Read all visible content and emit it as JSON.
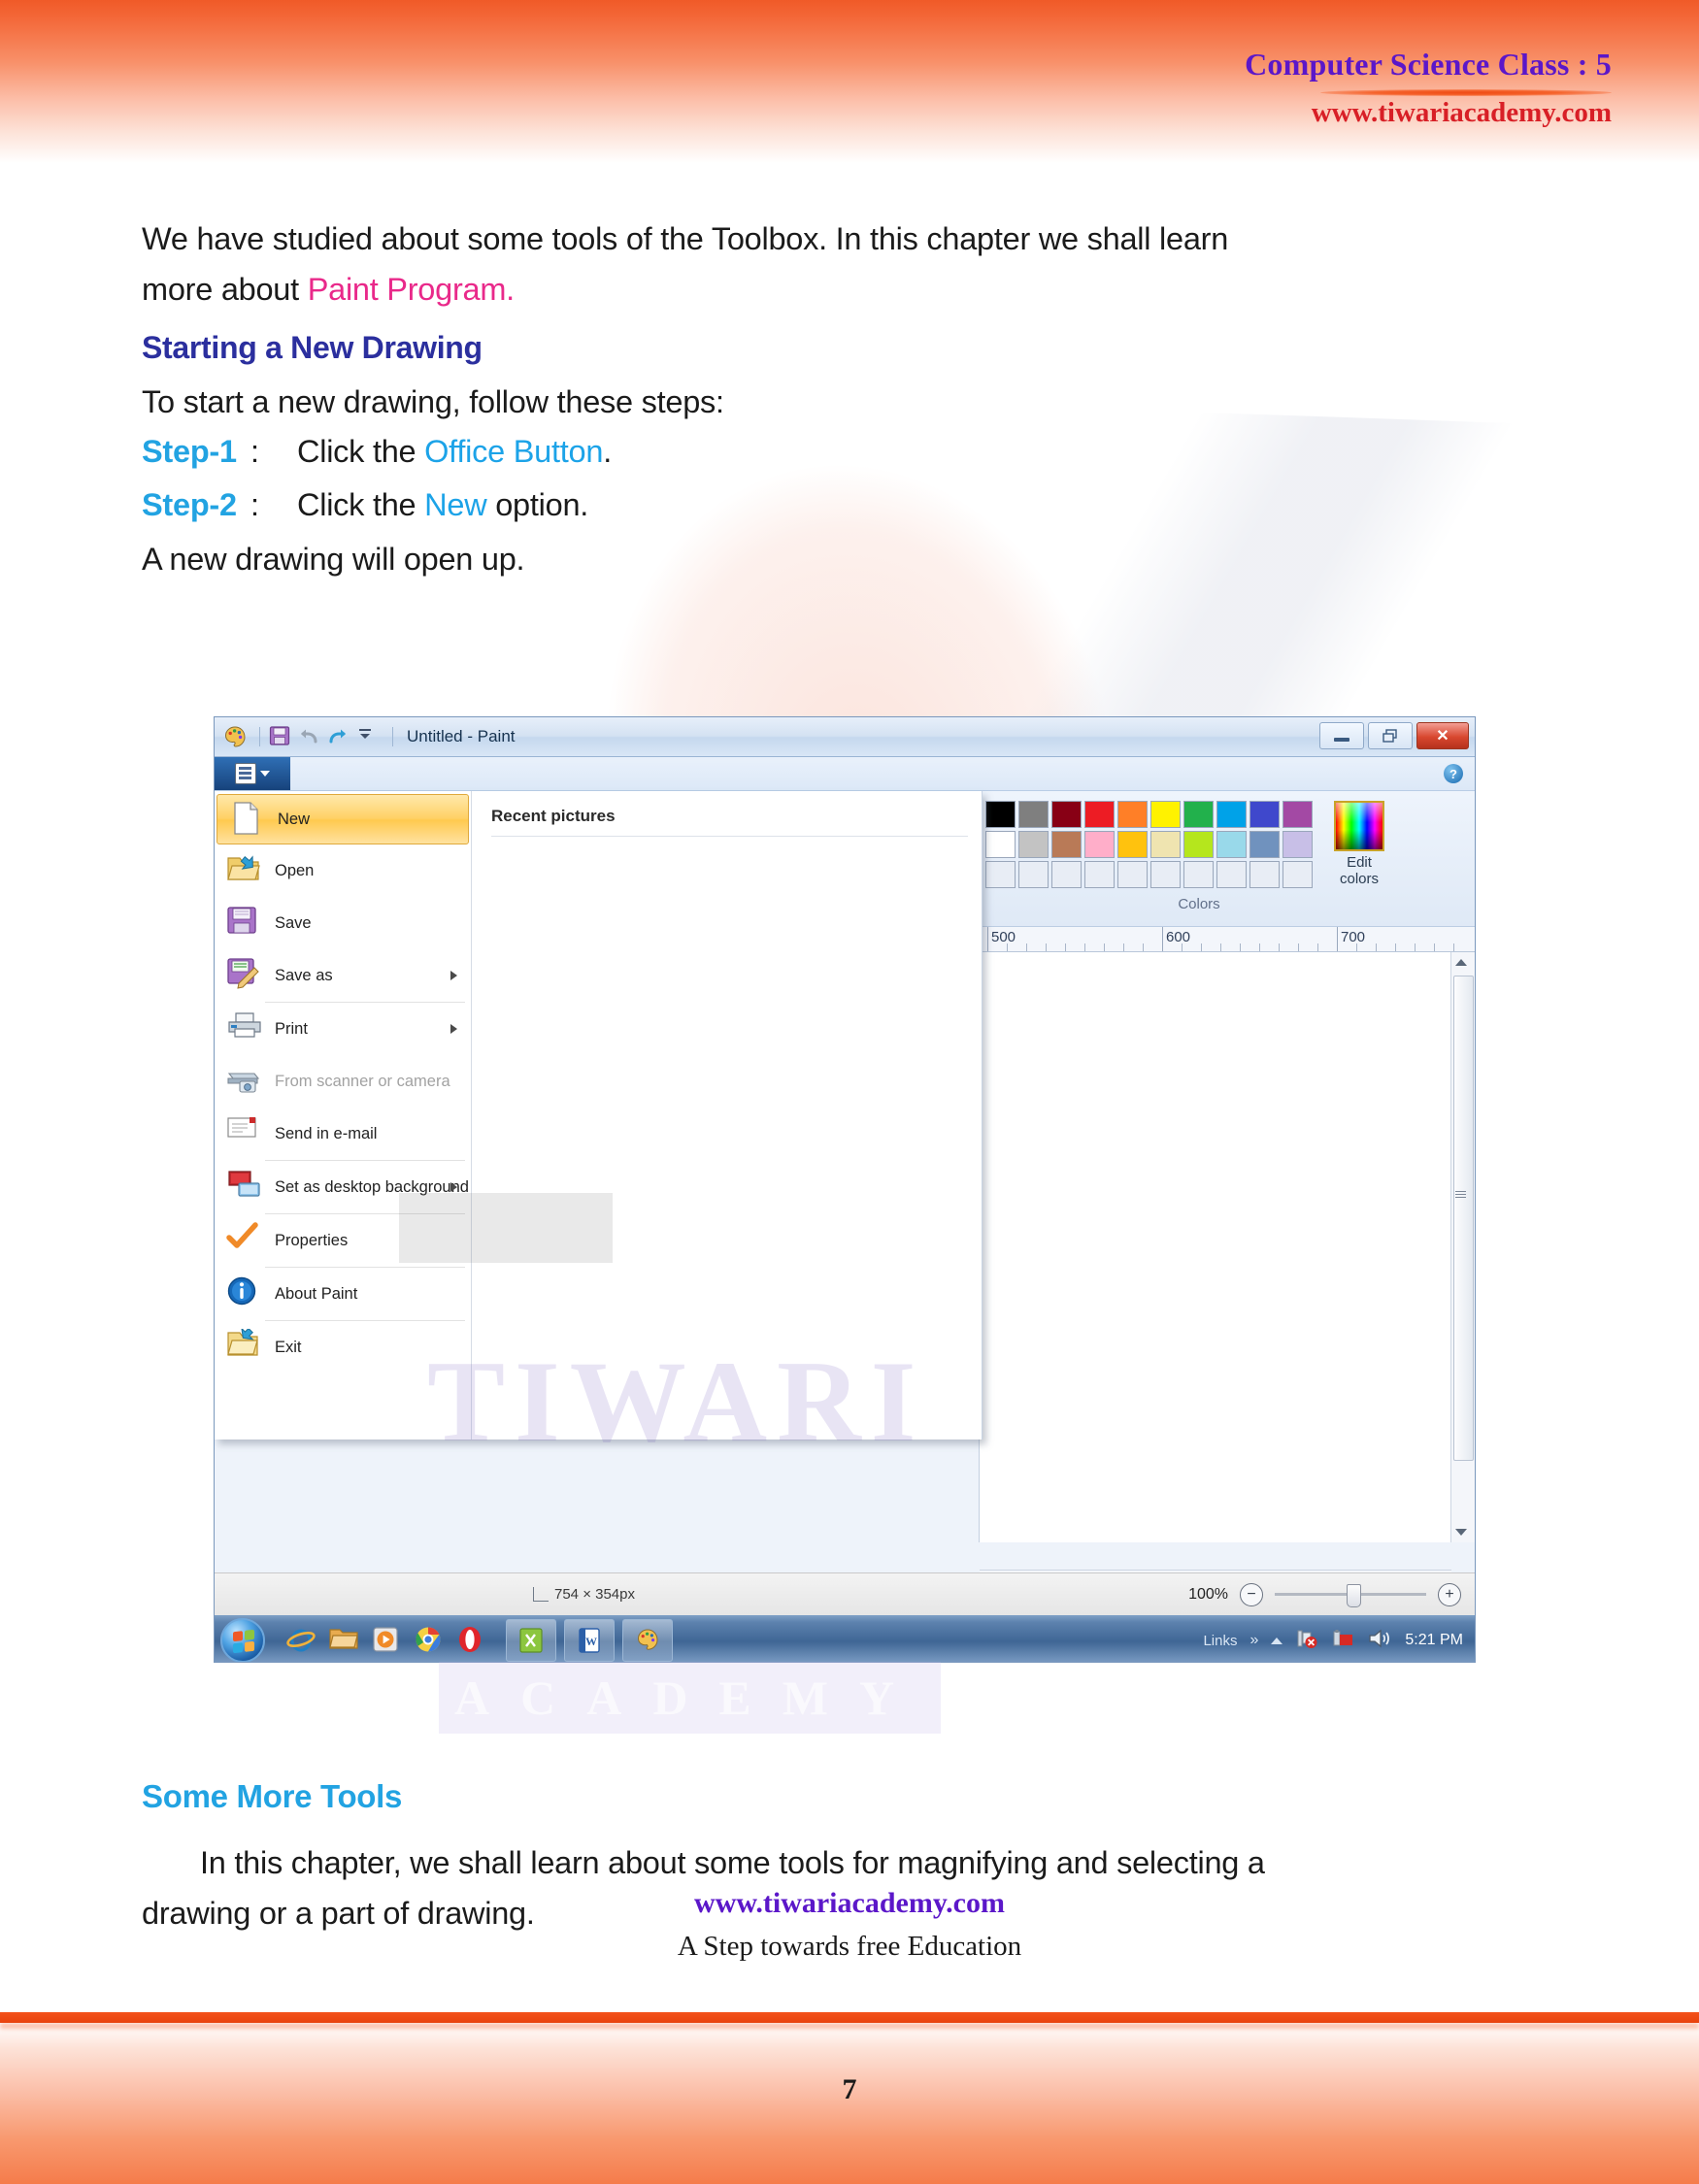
{
  "header": {
    "title": "Computer Science Class : 5",
    "site": "www.tiwariacademy.com"
  },
  "body": {
    "intro_1": "We have studied about some tools of the Toolbox. In this chapter we shall learn",
    "intro_2_pre": "more about ",
    "intro_2_em": "Paint Program.",
    "heading_1": "Starting a New Drawing",
    "lead": "To start a new drawing, follow these steps:",
    "steps": [
      {
        "label": "Step-1",
        "colon": ":",
        "pre": "Click the ",
        "em": "Office Button",
        "post": "."
      },
      {
        "label": "Step-2",
        "colon": ":",
        "pre": "Click the ",
        "em": "New",
        "post": " option."
      }
    ],
    "after_steps": "A new drawing will open up.",
    "heading_2": "Some More Tools",
    "closing_1": "In this chapter, we shall learn about some tools for magnifying and selecting  a",
    "closing_2": "drawing or a part of drawing."
  },
  "screenshot": {
    "window_title": "Untitled - Paint",
    "quick_access": [
      {
        "name": "paint-palette-icon"
      },
      {
        "name": "save-icon"
      },
      {
        "name": "undo-icon"
      },
      {
        "name": "redo-icon"
      },
      {
        "name": "customize-qat-icon"
      }
    ],
    "window_buttons": {
      "minimize": "",
      "restore": "",
      "close": "✕"
    },
    "help_label": "?",
    "menu": {
      "items": [
        {
          "label": "New",
          "icon": "new-document-icon",
          "selected": true,
          "disabled": false,
          "submenu": false
        },
        {
          "label": "Open",
          "icon": "open-folder-icon",
          "selected": false,
          "disabled": false,
          "submenu": false
        },
        {
          "label": "Save",
          "icon": "floppy-disk-icon",
          "selected": false,
          "disabled": false,
          "submenu": false
        },
        {
          "label": "Save as",
          "icon": "save-as-icon",
          "selected": false,
          "disabled": false,
          "submenu": true
        },
        {
          "label": "Print",
          "icon": "printer-icon",
          "selected": false,
          "disabled": false,
          "submenu": true
        },
        {
          "label": "From scanner or camera",
          "icon": "scanner-camera-icon",
          "selected": false,
          "disabled": true,
          "submenu": false
        },
        {
          "label": "Send in e-mail",
          "icon": "envelope-icon",
          "selected": false,
          "disabled": false,
          "submenu": false
        },
        {
          "label": "Set as desktop background",
          "icon": "desktop-background-icon",
          "selected": false,
          "disabled": false,
          "submenu": true
        },
        {
          "label": "Properties",
          "icon": "checkmark-icon",
          "selected": false,
          "disabled": false,
          "submenu": false
        },
        {
          "label": "About Paint",
          "icon": "info-icon",
          "selected": false,
          "disabled": false,
          "submenu": false
        },
        {
          "label": "Exit",
          "icon": "exit-folder-icon",
          "selected": false,
          "disabled": false,
          "submenu": false
        }
      ]
    },
    "recent_pictures_heading": "Recent pictures",
    "colors": {
      "caption": "Colors",
      "edit_colors_line1": "Edit",
      "edit_colors_line2": "colors",
      "row1": [
        "#000000",
        "#7f7f7f",
        "#880015",
        "#ed1c24",
        "#ff7f27",
        "#fff200",
        "#22b14c",
        "#00a2e8",
        "#3f48cc",
        "#a349a4"
      ],
      "row2": [
        "#ffffff",
        "#c3c3c3",
        "#b97a57",
        "#ffaec9",
        "#ffc20e",
        "#efe4b0",
        "#b5e61d",
        "#99d9ea",
        "#7092be",
        "#c8bfe7"
      ],
      "row3": [
        "#e8edf5",
        "#e8edf5",
        "#e8edf5",
        "#e8edf5",
        "#e8edf5",
        "#e8edf5",
        "#e8edf5",
        "#e8edf5",
        "#e8edf5",
        "#e8edf5"
      ]
    },
    "ruler_labels": [
      "500",
      "600",
      "700"
    ],
    "status": {
      "canvas_size": "754 × 354px",
      "zoom_percent": "100%",
      "zoom_out": "−",
      "zoom_in": "+"
    },
    "taskbar": {
      "start_label": "Start",
      "quick_launch": [
        {
          "name": "internet-explorer-icon"
        },
        {
          "name": "windows-explorer-icon"
        },
        {
          "name": "media-player-icon"
        },
        {
          "name": "chrome-icon"
        },
        {
          "name": "opera-icon"
        }
      ],
      "open_windows": [
        {
          "name": "excel-window-button"
        },
        {
          "name": "word-window-button"
        },
        {
          "name": "paint-window-button"
        }
      ],
      "tray_label": "Links",
      "tray_chevron": "»",
      "time": "5:21 PM"
    }
  },
  "watermark": {
    "line1": "TIWARI",
    "line2": "ACADEMY"
  },
  "footer": {
    "site": "www.tiwariacademy.com",
    "tagline": "A Step towards free Education",
    "page_number": "7"
  }
}
